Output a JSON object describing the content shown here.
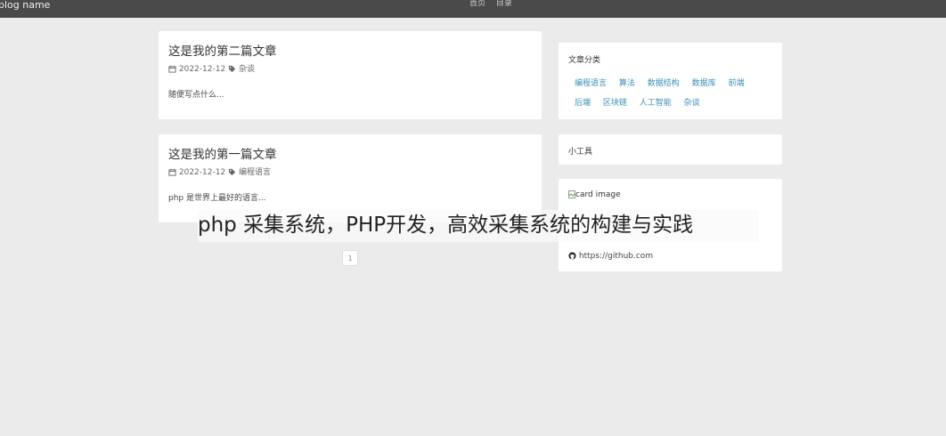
{
  "navbar": {
    "brand": "blog name",
    "links": [
      "首页",
      "目录"
    ]
  },
  "posts": [
    {
      "title": "这是我的第二篇文章",
      "date": "2022-12-12",
      "category": "杂谈",
      "excerpt": "随便写点什么..."
    },
    {
      "title": "这是我的第一篇文章",
      "date": "2022-12-12",
      "category": "编程语言",
      "excerpt": "php 是世界上最好的语言..."
    }
  ],
  "pagination": {
    "current": "1"
  },
  "sidebar": {
    "categories_title": "文章分类",
    "categories_row1": [
      "编程语言",
      "算法",
      "数据结构",
      "数据库",
      "前端"
    ],
    "categories_row2": [
      "后端",
      "区块链",
      "人工智能",
      "杂谈"
    ],
    "tools_title": "小工具",
    "card_image_alt": "card image",
    "github_link": "https://github.com"
  },
  "overlay": {
    "text": "php 采集系统，PHP开发，高效采集系统的构建与实践"
  },
  "colors": {
    "navbar": "#4a4a4a",
    "background": "#ebebeb",
    "link": "#3a8fb7"
  }
}
